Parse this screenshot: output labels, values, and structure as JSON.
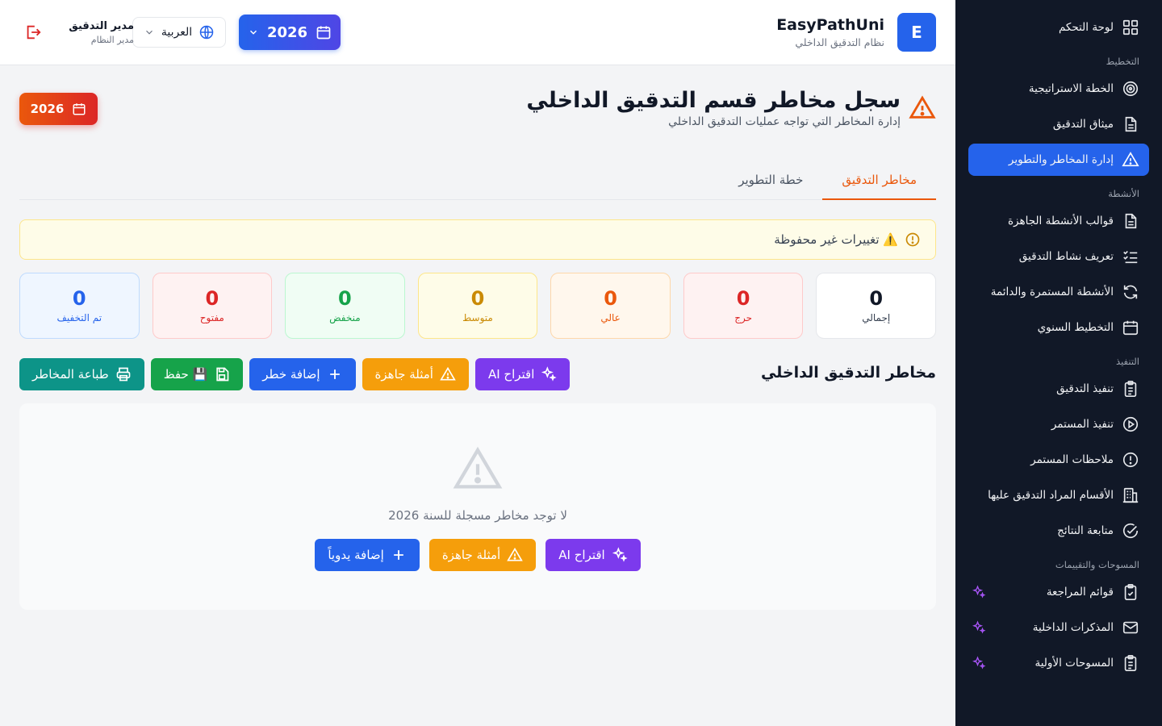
{
  "header": {
    "logo_letter": "E",
    "brand_title": "EasyPathUni",
    "brand_subtitle": "نظام التدقيق الداخلي",
    "year": "2026",
    "language": "العربية",
    "user_name": "مدير التدقيق",
    "user_role": "مدير النظام"
  },
  "sidebar": {
    "dashboard": "لوحة التحكم",
    "sections": {
      "planning": "التخطيط",
      "activities": "الأنشطة",
      "execution": "التنفيذ",
      "surveys": "المسوحات والتقييمات"
    },
    "planning_items": [
      "الخطة الاستراتيجية",
      "ميثاق التدقيق",
      "إدارة المخاطر والتطوير"
    ],
    "activities_items": [
      "قوالب الأنشطة الجاهزة",
      "تعريف نشاط التدقيق",
      "الأنشطة المستمرة والدائمة",
      "التخطيط السنوي"
    ],
    "execution_items": [
      "تنفيذ التدقيق",
      "تنفيذ المستمر",
      "ملاحظات المستمر",
      "الأقسام المراد التدقيق عليها",
      "متابعة النتائج"
    ],
    "surveys_items": [
      "قوائم المراجعة",
      "المذكرات الداخلية",
      "المسوحات الأولية"
    ]
  },
  "page": {
    "title": "سجل مخاطر قسم التدقيق الداخلي",
    "subtitle": "إدارة المخاطر التي تواجه عمليات التدقيق الداخلي",
    "year_badge": "2026",
    "tabs": [
      "مخاطر التدقيق",
      "خطة التطوير"
    ],
    "unsaved_warning": "⚠️ تغييرات غير محفوظة",
    "stats": [
      {
        "label": "إجمالي",
        "value": "0"
      },
      {
        "label": "حرج",
        "value": "0"
      },
      {
        "label": "عالي",
        "value": "0"
      },
      {
        "label": "متوسط",
        "value": "0"
      },
      {
        "label": "منخفض",
        "value": "0"
      },
      {
        "label": "مفتوح",
        "value": "0"
      },
      {
        "label": "تم التخفيف",
        "value": "0"
      }
    ],
    "section_title": "مخاطر التدقيق الداخلي",
    "actions": {
      "ai_suggest": "اقتراح AI",
      "ready_examples": "أمثلة جاهزة",
      "add_risk": "إضافة خطر",
      "save": "💾 حفظ",
      "print": "طباعة المخاطر"
    },
    "empty": {
      "message": "لا توجد مخاطر مسجلة للسنة 2026",
      "ai_suggest": "اقتراح AI",
      "ready_examples": "أمثلة جاهزة",
      "add_manual": "إضافة يدوياً"
    }
  },
  "colors": {
    "primary": "#2563eb",
    "sidebar_bg": "#111827",
    "accent_orange": "#ea580c",
    "purple": "#7c3aed",
    "amber": "#f59e0b",
    "green": "#16a34a",
    "teal": "#0d9488"
  }
}
